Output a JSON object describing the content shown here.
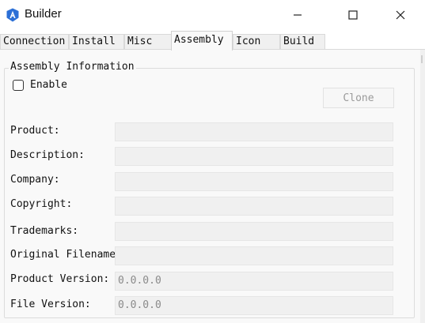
{
  "window": {
    "title": "Builder",
    "accent_color": "#2b6fd6"
  },
  "tabs": [
    {
      "label": "Connection",
      "active": false
    },
    {
      "label": "Install",
      "active": false
    },
    {
      "label": "Misc",
      "active": false
    },
    {
      "label": "Assembly",
      "active": true
    },
    {
      "label": "Icon",
      "active": false
    },
    {
      "label": "Build",
      "active": false
    }
  ],
  "assembly": {
    "group_title": "Assembly Information",
    "enable_label": "Enable",
    "enable_checked": false,
    "clone_label": "Clone",
    "fields": [
      {
        "label": "Product:",
        "value": ""
      },
      {
        "label": "Description:",
        "value": ""
      },
      {
        "label": "Company:",
        "value": ""
      },
      {
        "label": "Copyright:",
        "value": ""
      },
      {
        "label": "Trademarks:",
        "value": ""
      },
      {
        "label": "Original Filename:",
        "value": ""
      },
      {
        "label": "Product Version:",
        "value": "0.0.0.0"
      },
      {
        "label": "File Version:",
        "value": "0.0.0.0"
      }
    ]
  }
}
